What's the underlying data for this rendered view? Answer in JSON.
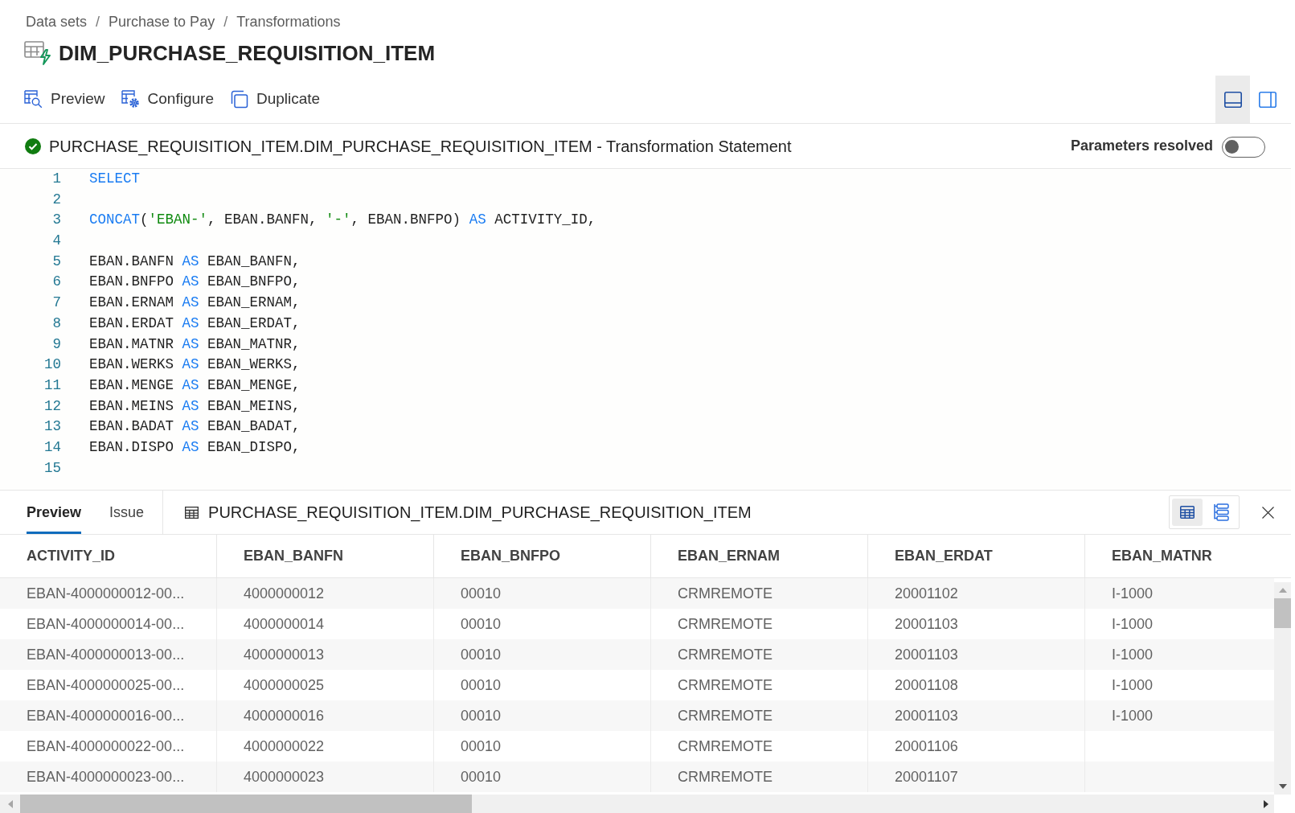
{
  "breadcrumb": [
    {
      "kind": "link",
      "text": "Data sets"
    },
    {
      "kind": "separator",
      "text": "/"
    },
    {
      "kind": "link",
      "text": "Purchase to Pay"
    },
    {
      "kind": "separator",
      "text": "/"
    },
    {
      "kind": "link",
      "text": "Transformations"
    }
  ],
  "title": "DIM_PURCHASE_REQUISITION_ITEM",
  "toolbar": {
    "actions": [
      {
        "label": "Preview"
      },
      {
        "label": "Configure"
      },
      {
        "label": "Duplicate"
      }
    ],
    "layout_options": [
      {
        "selected": true
      },
      {
        "selected": false
      }
    ]
  },
  "statement": {
    "valid": true,
    "title": "PURCHASE_REQUISITION_ITEM.DIM_PURCHASE_REQUISITION_ITEM - Transformation Statement",
    "parameters_toggle": {
      "label": "Parameters resolved",
      "on": false
    }
  },
  "code": {
    "lines": [
      {
        "number": "1",
        "tokens": [
          {
            "kind": "keyword",
            "text": "SELECT"
          }
        ]
      },
      {
        "number": "2"
      },
      {
        "number": "3",
        "tokens": [
          {
            "kind": "keyword",
            "text": "CONCAT"
          },
          {
            "kind": "plain",
            "text": "("
          },
          {
            "kind": "string",
            "text": "'EBAN-'"
          },
          {
            "kind": "plain",
            "text": ", EBAN.BANFN, "
          },
          {
            "kind": "string",
            "text": "'-'"
          },
          {
            "kind": "plain",
            "text": ", EBAN.BNFPO) "
          },
          {
            "kind": "keyword",
            "text": "AS"
          },
          {
            "kind": "plain",
            "text": " ACTIVITY_ID,"
          }
        ]
      },
      {
        "number": "4"
      },
      {
        "number": "5",
        "tokens": [
          {
            "kind": "plain",
            "text": "EBAN.BANFN "
          },
          {
            "kind": "keyword",
            "text": "AS"
          },
          {
            "kind": "plain",
            "text": " EBAN_BANFN,"
          }
        ]
      },
      {
        "number": "6",
        "tokens": [
          {
            "kind": "plain",
            "text": "EBAN.BNFPO "
          },
          {
            "kind": "keyword",
            "text": "AS"
          },
          {
            "kind": "plain",
            "text": " EBAN_BNFPO,"
          }
        ]
      },
      {
        "number": "7",
        "tokens": [
          {
            "kind": "plain",
            "text": "EBAN.ERNAM "
          },
          {
            "kind": "keyword",
            "text": "AS"
          },
          {
            "kind": "plain",
            "text": " EBAN_ERNAM,"
          }
        ]
      },
      {
        "number": "8",
        "tokens": [
          {
            "kind": "plain",
            "text": "EBAN.ERDAT "
          },
          {
            "kind": "keyword",
            "text": "AS"
          },
          {
            "kind": "plain",
            "text": " EBAN_ERDAT,"
          }
        ]
      },
      {
        "number": "9",
        "tokens": [
          {
            "kind": "plain",
            "text": "EBAN.MATNR "
          },
          {
            "kind": "keyword",
            "text": "AS"
          },
          {
            "kind": "plain",
            "text": " EBAN_MATNR,"
          }
        ]
      },
      {
        "number": "10",
        "tokens": [
          {
            "kind": "plain",
            "text": "EBAN.WERKS "
          },
          {
            "kind": "keyword",
            "text": "AS"
          },
          {
            "kind": "plain",
            "text": " EBAN_WERKS,"
          }
        ]
      },
      {
        "number": "11",
        "tokens": [
          {
            "kind": "plain",
            "text": "EBAN.MENGE "
          },
          {
            "kind": "keyword",
            "text": "AS"
          },
          {
            "kind": "plain",
            "text": " EBAN_MENGE,"
          }
        ]
      },
      {
        "number": "12",
        "tokens": [
          {
            "kind": "plain",
            "text": "EBAN.MEINS "
          },
          {
            "kind": "keyword",
            "text": "AS"
          },
          {
            "kind": "plain",
            "text": " EBAN_MEINS,"
          }
        ]
      },
      {
        "number": "13",
        "tokens": [
          {
            "kind": "plain",
            "text": "EBAN.BADAT "
          },
          {
            "kind": "keyword",
            "text": "AS"
          },
          {
            "kind": "plain",
            "text": " EBAN_BADAT,"
          }
        ]
      },
      {
        "number": "14",
        "tokens": [
          {
            "kind": "plain",
            "text": "EBAN.DISPO "
          },
          {
            "kind": "keyword",
            "text": "AS"
          },
          {
            "kind": "plain",
            "text": " EBAN_DISPO,"
          }
        ]
      },
      {
        "number": "15"
      }
    ]
  },
  "bottom_panel": {
    "tabs": [
      {
        "label": "Preview",
        "selected": true
      },
      {
        "label": "Issue",
        "selected": false
      }
    ],
    "table_name": "PURCHASE_REQUISITION_ITEM.DIM_PURCHASE_REQUISITION_ITEM",
    "view_options": [
      {
        "selected": true
      },
      {
        "selected": false
      }
    ],
    "table": {
      "columns": [
        "ACTIVITY_ID",
        "EBAN_BANFN",
        "EBAN_BNFPO",
        "EBAN_ERNAM",
        "EBAN_ERDAT",
        "EBAN_MATNR"
      ],
      "rows": [
        [
          "EBAN-4000000012-00...",
          "4000000012",
          "00010",
          "CRMREMOTE",
          "20001102",
          "I-1000"
        ],
        [
          "EBAN-4000000014-00...",
          "4000000014",
          "00010",
          "CRMREMOTE",
          "20001103",
          "I-1000"
        ],
        [
          "EBAN-4000000013-00...",
          "4000000013",
          "00010",
          "CRMREMOTE",
          "20001103",
          "I-1000"
        ],
        [
          "EBAN-4000000025-00...",
          "4000000025",
          "00010",
          "CRMREMOTE",
          "20001108",
          "I-1000"
        ],
        [
          "EBAN-4000000016-00...",
          "4000000016",
          "00010",
          "CRMREMOTE",
          "20001103",
          "I-1000"
        ],
        [
          "EBAN-4000000022-00...",
          "4000000022",
          "00010",
          "CRMREMOTE",
          "20001106"
        ],
        [
          "EBAN-4000000023-00...",
          "4000000023",
          "00010",
          "CRMREMOTE",
          "20001107"
        ]
      ]
    }
  }
}
